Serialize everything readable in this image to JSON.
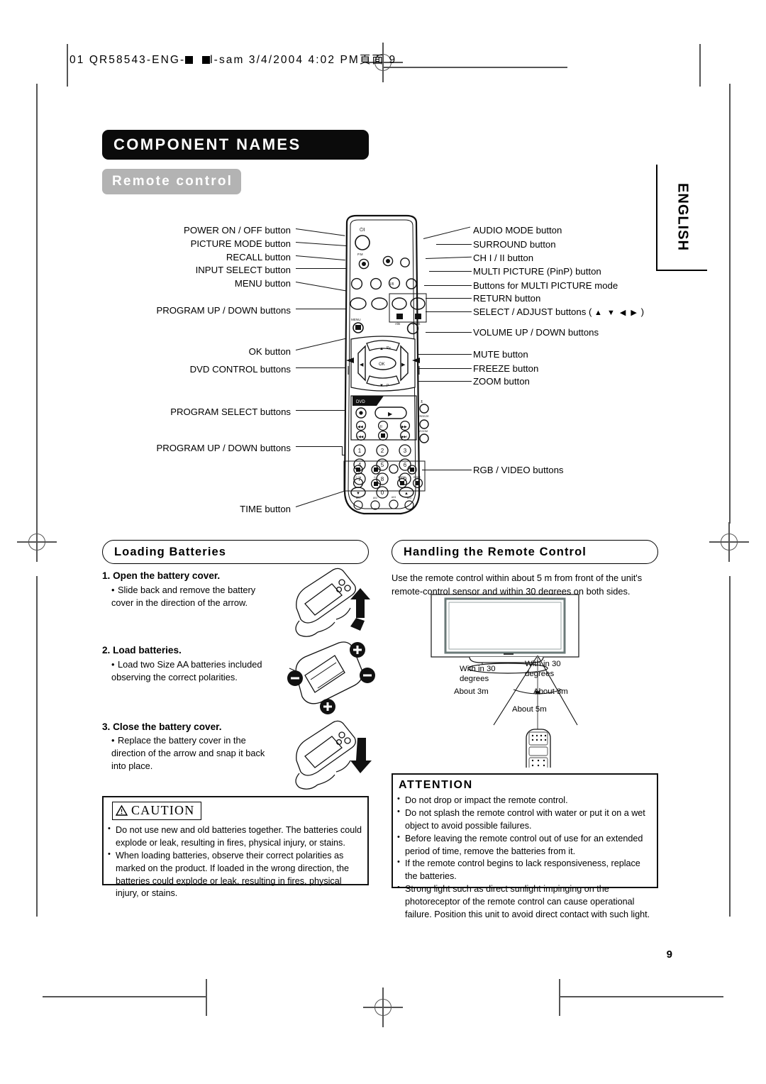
{
  "imprint": {
    "prefix": "01 QR58543-ENG-",
    "mid": "l-sam  3/4/2004  4:02 PM",
    "suffix": "頁面 9"
  },
  "side_tab": {
    "label": "ENGLISH"
  },
  "headings": {
    "chapter": "COMPONENT NAMES",
    "section": "Remote control"
  },
  "callouts": {
    "left": [
      {
        "label": "POWER ON / OFF button"
      },
      {
        "label": "PICTURE MODE button"
      },
      {
        "label": "RECALL button"
      },
      {
        "label": "INPUT SELECT button"
      },
      {
        "label": "MENU button"
      },
      {
        "label": "PROGRAM UP / DOWN buttons"
      },
      {
        "label": "OK button"
      },
      {
        "label": "DVD CONTROL buttons"
      },
      {
        "label": "PROGRAM SELECT buttons"
      },
      {
        "label": "PROGRAM UP / DOWN buttons"
      },
      {
        "label": "TIME button"
      }
    ],
    "right": [
      {
        "label": "AUDIO MODE button"
      },
      {
        "label": "SURROUND button"
      },
      {
        "label": "CH I / II button"
      },
      {
        "label": "MULTI PICTURE (PinP) button"
      },
      {
        "label": "Buttons for MULTI PICTURE mode"
      },
      {
        "label": "RETURN button"
      },
      {
        "label": "SELECT / ADJUST buttons (",
        "glyphs": "▲ ▼ ◀ ▶",
        "label_end": ")"
      },
      {
        "label": "VOLUME UP / DOWN buttons"
      },
      {
        "label": "MUTE button"
      },
      {
        "label": "FREEZE button"
      },
      {
        "label": "ZOOM button"
      },
      {
        "label": "RGB / VIDEO buttons"
      }
    ]
  },
  "loading_batteries": {
    "title": "Loading Batteries",
    "steps": [
      {
        "heading": "1. Open the battery cover.",
        "body": "Slide back and remove the battery cover in the direction of the arrow."
      },
      {
        "heading": "2. Load batteries.",
        "body": "Load two Size AA batteries included observing the correct polarities."
      },
      {
        "heading": "3. Close the battery cover.",
        "body": "Replace the battery cover in the direction of the arrow and snap it back into place."
      }
    ]
  },
  "caution": {
    "label": "CAUTION",
    "items": [
      "Do not use new and old batteries together.  The batteries could explode or leak, resulting in fires, physical injury, or stains.",
      "When loading batteries, observe their correct polarities as marked on the product. If loaded in the wrong direction, the batteries could explode or leak, resulting in fires, physical injury, or stains."
    ]
  },
  "handling": {
    "title": "Handling the Remote Control",
    "intro": "Use the remote control within about 5 m from front of the unit's remote-control sensor and within 30 degrees on both sides.",
    "diagram": {
      "left_angle": "With in 30\ndegrees",
      "right_angle": "With in 30\ndegrees",
      "left_distance": "About 3m",
      "right_distance": "About 3m",
      "center_distance": "About 5m"
    }
  },
  "attention": {
    "title": "ATTENTION",
    "items": [
      "Do not drop or impact the remote control.",
      "Do not splash the remote control with water or put it on a wet object to avoid possible failures.",
      "Before leaving the remote control out of use for an extended period of time, remove the batteries from it.",
      "If the remote control begins to lack responsiveness, replace the batteries.",
      "Strong light such as direct sunlight impinging on the photoreceptor of the remote control can cause operational failure. Position this unit to avoid direct contact with such light."
    ]
  },
  "remote_keys": {
    "dvd_label": "DVD",
    "numbers": [
      "1",
      "2",
      "3",
      "4",
      "5",
      "6",
      "7",
      "8",
      "9",
      "0"
    ],
    "mode_labels": [
      "A/B",
      "S-P/S"
    ],
    "nav_labels": [
      "P+",
      "P-"
    ],
    "ok": "OK",
    "menu": "MENU",
    "freeze": "FREEZE",
    "zoom": "ZOOM",
    "bottom_labels": [
      "AV1",
      "AV2",
      "AV3",
      "AV4",
      "RGB1",
      "RGB2"
    ]
  },
  "page_number": "9",
  "colors": {
    "title_bg": "#0b0b0b",
    "section_bg": "#b3b3b3",
    "ink": "#111111",
    "mark": "#555555"
  }
}
